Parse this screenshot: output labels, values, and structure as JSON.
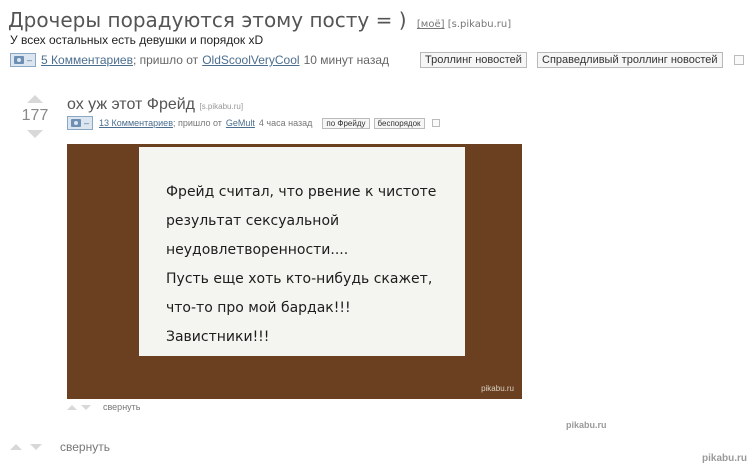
{
  "main_post": {
    "title": "Дрочеры порадуются этому посту = )",
    "mine_link": "[моё]",
    "source": "[s.pikabu.ru]",
    "subtitle": "У всех остальных есть девушки и порядок xD",
    "comments": "5 Комментариев",
    "posted_by_prefix": "; пришло от",
    "author": "OldScoolVeryCool",
    "time": "10 минут назад",
    "tags": [
      "Троллинг новостей",
      "Справедливый троллинг новостей"
    ]
  },
  "repost": {
    "votes": "177",
    "title": "ох уж этот Фрейд",
    "source": "[s.pikabu.ru]",
    "comments": "13 Комментариев",
    "posted_by_prefix": "; пришло от",
    "author": "GeMult",
    "time": "4 часа назад",
    "tags": [
      "по Фрейду",
      "беспорядок"
    ],
    "image_text": [
      "Фрейд считал, что рвение к чистоте",
      "результат  сексуальной",
      "неудовлетворенности....",
      "Пусть еще хоть кто-нибудь скажет,",
      "что-то про мой бардак!!!",
      "Завистники!!!"
    ],
    "image_watermark": "pikabu.ru",
    "collapse_label": "свернуть"
  },
  "bottom": {
    "collapse_label": "свернуть",
    "watermark_mid": "pikabu.ru",
    "watermark_corner": "pikabu.ru"
  },
  "camera_minus": "–"
}
